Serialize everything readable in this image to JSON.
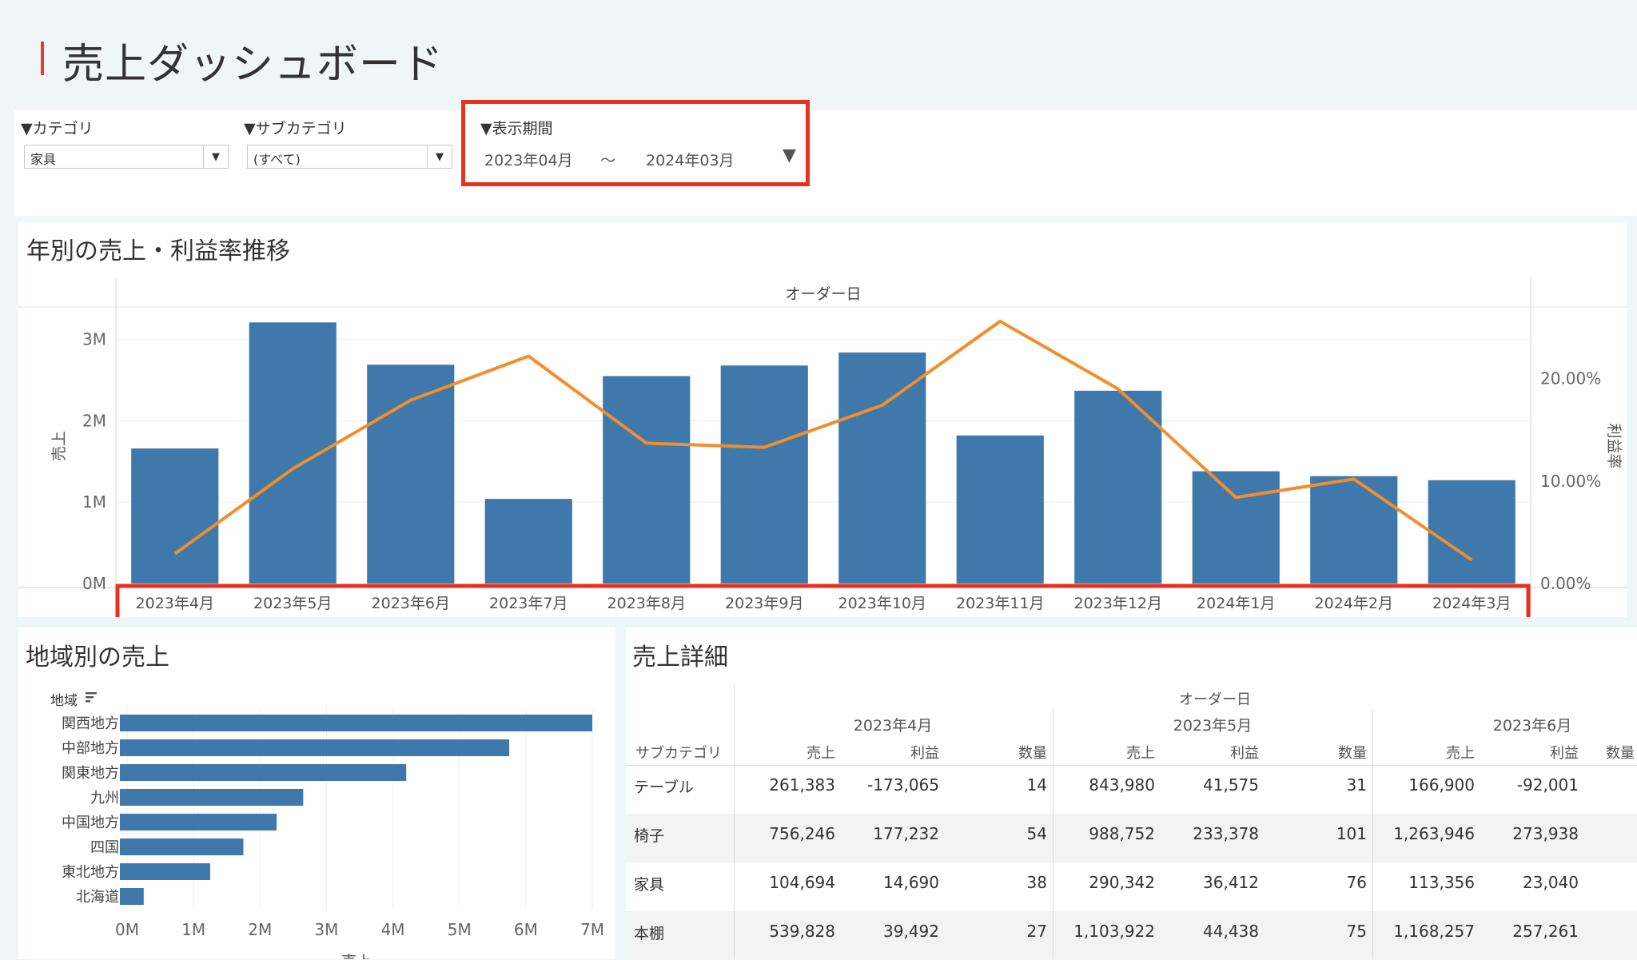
{
  "page": {
    "title": "売上ダッシュボード",
    "accent_color": "#e33a2e",
    "bar_color": "#3f78aa",
    "line_color": "#f28e2b",
    "highlight_color": "#e8321f"
  },
  "filters": {
    "category": {
      "label": "▼カテゴリ",
      "value": "家具"
    },
    "subcategory": {
      "label": "▼サブカテゴリ",
      "value": "(すべて)"
    },
    "period": {
      "label": "▼表示期間",
      "start": "2023年04月",
      "separator": "〜",
      "end": "2024年03月"
    }
  },
  "sales_chart": {
    "title": "年別の売上・利益率推移",
    "x_header": "オーダー日",
    "y_left_label": "売上",
    "y_right_label": "利益率",
    "y_left_ticks": [
      "0M",
      "1M",
      "2M",
      "3M"
    ],
    "y_right_ticks": [
      "0.00%",
      "10.00%",
      "20.00%"
    ]
  },
  "chart_data": [
    {
      "type": "bar",
      "title": "年別の売上・利益率推移",
      "xlabel": "オーダー日",
      "ylabel": "売上",
      "y2label": "利益率",
      "categories": [
        "2023年4月",
        "2023年5月",
        "2023年6月",
        "2023年7月",
        "2023年8月",
        "2023年9月",
        "2023年10月",
        "2023年11月",
        "2023年12月",
        "2024年1月",
        "2024年2月",
        "2024年3月"
      ],
      "series": [
        {
          "name": "売上",
          "type": "bar",
          "values": [
            1660000,
            3210000,
            2690000,
            1040000,
            2550000,
            2680000,
            2840000,
            1820000,
            2370000,
            1380000,
            1320000,
            1270000
          ]
        },
        {
          "name": "利益率",
          "type": "line",
          "axis": "right",
          "values": [
            0.029,
            0.112,
            0.179,
            0.222,
            0.137,
            0.133,
            0.174,
            0.256,
            0.19,
            0.084,
            0.102,
            0.023
          ]
        }
      ],
      "ylim": [
        0,
        3400000
      ],
      "y2lim": [
        0,
        0.27
      ],
      "grid": true
    },
    {
      "type": "bar",
      "orientation": "horizontal",
      "title": "地域別の売上",
      "ylabel": "地域",
      "xlabel": "売上",
      "categories": [
        "関西地方",
        "中部地方",
        "関東地方",
        "九州",
        "中国地方",
        "四国",
        "東北地方",
        "北海道"
      ],
      "values": [
        7000000,
        5750000,
        4200000,
        2650000,
        2250000,
        1750000,
        1250000,
        250000
      ],
      "xlim": [
        0,
        7000000
      ],
      "x_ticks": [
        "0M",
        "1M",
        "2M",
        "3M",
        "4M",
        "5M",
        "6M",
        "7M"
      ],
      "grid": true
    }
  ],
  "region_chart": {
    "title": "地域別の売上",
    "axis_label": "地域",
    "value_label": "売上"
  },
  "detail_table": {
    "title": "売上詳細",
    "column_group": "オーダー日",
    "row_header": "サブカテゴリ",
    "months": [
      "2023年4月",
      "2023年5月",
      "2023年6月"
    ],
    "measures": [
      "売上",
      "利益",
      "数量"
    ],
    "rows": [
      {
        "name": "テーブル",
        "values": [
          "261,383",
          "-173,065",
          "14",
          "843,980",
          "41,575",
          "31",
          "166,900",
          "-92,001"
        ]
      },
      {
        "name": "椅子",
        "values": [
          "756,246",
          "177,232",
          "54",
          "988,752",
          "233,378",
          "101",
          "1,263,946",
          "273,938"
        ]
      },
      {
        "name": "家具",
        "values": [
          "104,694",
          "14,690",
          "38",
          "290,342",
          "36,412",
          "76",
          "113,356",
          "23,040"
        ]
      },
      {
        "name": "本棚",
        "values": [
          "539,828",
          "39,492",
          "27",
          "1,103,922",
          "44,438",
          "75",
          "1,168,257",
          "257,261"
        ]
      }
    ]
  }
}
